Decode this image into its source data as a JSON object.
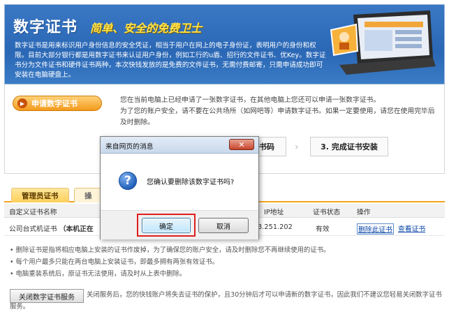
{
  "banner": {
    "title": "数字证书",
    "subtitle": "简单、安全的免费卫士",
    "description": "数字证书是用来标识用户身份信息的安全凭证，相当于用户在网上的电子身份证，表明用户的身份和权限。目前大部分银行都是用数字证书来认证用户身份，例如工行的u盾、招行的文件证书、优Key。数字证书分为文件证书和硬件证书两种，本次快钱发放的是免费的文件证书，无需付费邮寄，只需申请成功即可安装在电脑硬盘上。"
  },
  "apply": {
    "button_label": "申请数字证书",
    "info_line1": "您在当前电脑上已经申请了一张数字证书，在其他电脑上您还可以申请一张数字证书。",
    "info_line2": "为了您的账户安全，请不要在公共场所（如网吧等）申请数字证书。如果一定要使用，请您在使用完毕后及时删除。"
  },
  "steps": {
    "step2_partial": "证书码",
    "step3": "3. 完成证书安装"
  },
  "tabs": {
    "active": "管理员证书",
    "other_partial": "操"
  },
  "table": {
    "headers": {
      "name": "自定义证书名称",
      "ip": "IP地址",
      "status": "证书状态",
      "actions": "操作"
    },
    "row": {
      "name_prefix": "公司台式机证书",
      "name_note": "（本机正在",
      "ip": "3.251.202",
      "status": "有效",
      "delete": "删除此证书",
      "view": "查看证书"
    }
  },
  "notes": [
    "• 删除证书是指将相应电脑上安装的证书作废掉，为了确保您的账户安全，请及时删除您不再继续使用的证书。",
    "• 每个用户最多只能在两台电脑上安装证书，即最多拥有两张有效证书。",
    "• 电脑重装系统后，原证书无法使用，请及时从上表中删除。"
  ],
  "close_service": {
    "button_label": "关闭数字证书服务",
    "text": "关闭服务后，您的快钱账户将失去证书的保护，且30分钟后才可以申请新的数字证书，因此我们不建议您轻易关闭数字证书服务。"
  },
  "dialog": {
    "title": "来自网页的消息",
    "close_label": "✕",
    "icon": "question-icon",
    "message": "您确认要删除该数字证书吗?",
    "ok_label": "确定",
    "cancel_label": "取消"
  }
}
